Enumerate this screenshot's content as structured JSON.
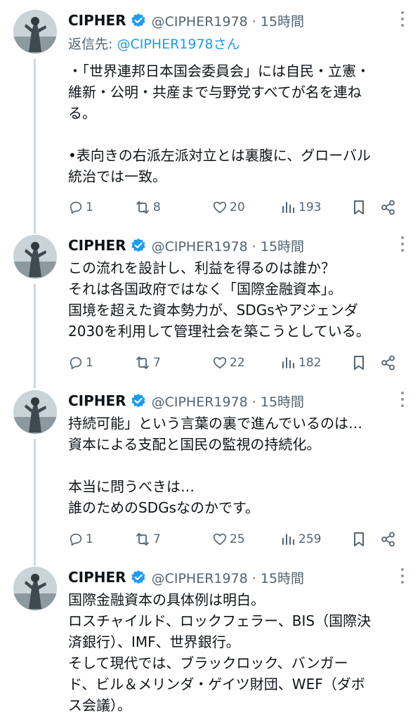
{
  "tweets": [
    {
      "name": "CIPHER",
      "handle": "@CIPHER1978 · 15時間",
      "reply_label": "返信先: ",
      "reply_mention": "@CIPHER1978さん",
      "body": [
        "・「世界連邦日本国会委員会」には自民・立憲・",
        "維新・公明・共産まで与野党すべてが名を連ね",
        "る。",
        "",
        "•表向きの右派左派対立とは裏腹に、グローバル",
        "統治では一致。"
      ],
      "replies": "1",
      "reposts": "8",
      "likes": "20",
      "views": "193"
    },
    {
      "name": "CIPHER",
      "handle": "@CIPHER1978 · 15時間",
      "body": [
        "この流れを設計し、利益を得るのは誰か？",
        "それは各国政府ではなく「国際金融資本」。",
        "国境を超えた資本勢力が、SDGsやアジェンダ",
        "2030を利用して管理社会を築こうとしている。"
      ],
      "replies": "1",
      "reposts": "7",
      "likes": "22",
      "views": "182"
    },
    {
      "name": "CIPHER",
      "handle": "@CIPHER1978 · 15時間",
      "body": [
        "持続可能」という言葉の裏で進んでいるのは…",
        "資本による支配と国民の監視の持続化。",
        "",
        "本当に問うべきは…",
        "誰のためのSDGsなのかです。"
      ],
      "replies": "1",
      "reposts": "7",
      "likes": "25",
      "views": "259"
    },
    {
      "name": "CIPHER",
      "handle": "@CIPHER1978 · 15時間",
      "body": [
        "国際金融資本の具体例は明白。",
        "ロスチャイルド、ロックフェラー、BIS（国際決",
        "済銀行）、IMF、世界銀行。",
        "そして現代では、ブラックロック、バンガー",
        "ド、ビル＆メリンダ・ゲイツ財団、WEF（ダボ",
        "ス会議）。"
      ]
    }
  ],
  "colors": {
    "text": "#0f1419",
    "secondary": "#536471",
    "link": "#1d9bf0",
    "verified": "#1d9bf0",
    "thread_line": "#cfd9de"
  },
  "icons": {
    "reply": "reply-icon",
    "repost": "repost-icon",
    "like": "heart-icon",
    "views": "views-icon",
    "bookmark": "bookmark-icon",
    "share": "share-icon",
    "verified": "verified-badge-icon",
    "more": "more-icon"
  }
}
